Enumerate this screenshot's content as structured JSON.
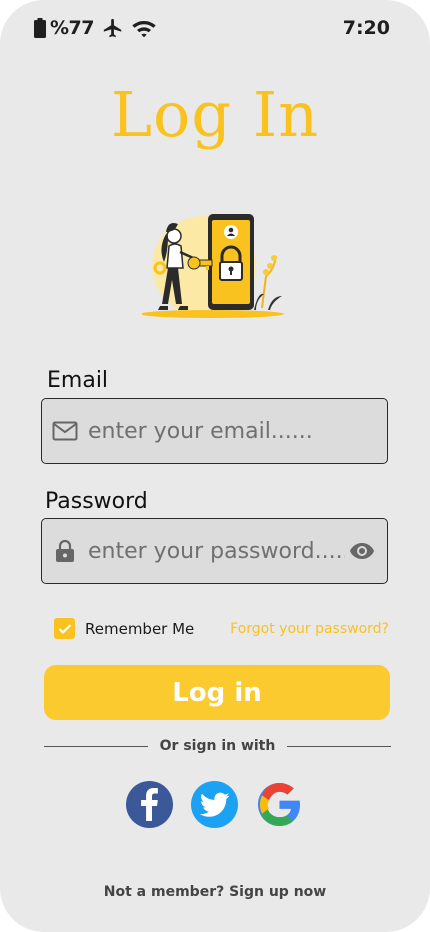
{
  "status_bar": {
    "battery": "%77",
    "time": "7:20",
    "icons": [
      "battery-icon",
      "airplane-icon",
      "wifi-icon"
    ]
  },
  "title": "Log In",
  "email": {
    "label": "Email",
    "placeholder": "enter your email......",
    "icon": "mail-icon"
  },
  "password": {
    "label": "Password",
    "placeholder": "enter your password......",
    "lead_icon": "lock-icon",
    "trail_icon": "eye-icon"
  },
  "remember": {
    "label": "Remember Me",
    "checked": true
  },
  "forgot_label": "Forgot your password?",
  "login_button": "Log in",
  "divider_text": "Or sign in with",
  "social": [
    "facebook-icon",
    "twitter-icon",
    "google-icon"
  ],
  "signup_text": "Not a member? Sign up now",
  "colors": {
    "accent": "#f9c21e",
    "background": "#e9e9e9",
    "field_bg": "#dcdcdc",
    "facebook": "#3b5998",
    "twitter": "#1da1f2"
  }
}
